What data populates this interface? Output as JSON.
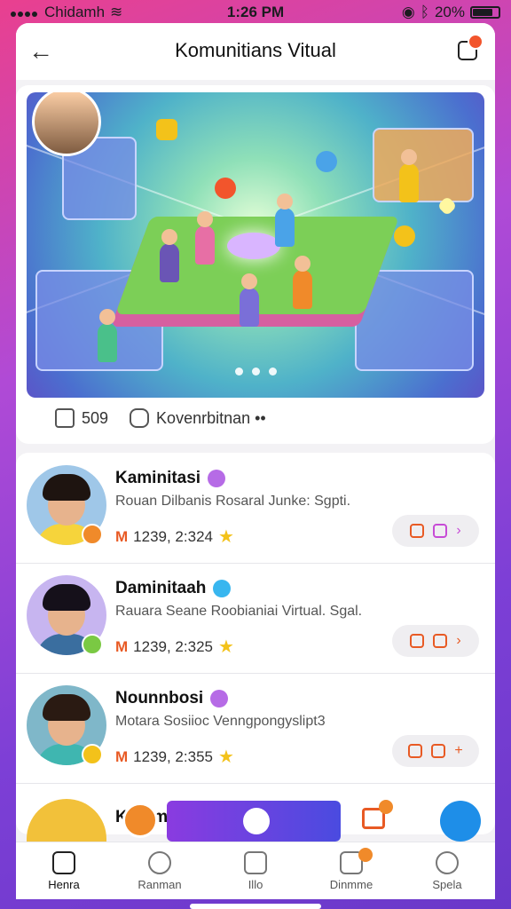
{
  "status": {
    "carrier": "Chidamh",
    "time": "1:26 PM",
    "battery": "20%"
  },
  "header": {
    "title": "Komunitians Vitual"
  },
  "hero": {
    "likes": "509",
    "comment_label": "Kovenrbitnan ••"
  },
  "list": [
    {
      "name": "Kaminitasi",
      "desc": "Rouan Dilbanis Rosaral Junke: Sgpti.",
      "stats": "1239, 2:324",
      "verified_color": "#b66be6",
      "corner_color": "#f08a2a",
      "hair": "#1e1410",
      "shirt": "#f6d43b",
      "bg": "#9fc7e8"
    },
    {
      "name": "Daminitaah",
      "desc": "Rauara Seane Roobianiai Virtual. Sgal.",
      "stats": "1239, 2:325",
      "verified_color": "#38b6ef",
      "corner_color": "#7ac943",
      "hair": "#15101a",
      "shirt": "#3a6e9f",
      "bg": "#c7b5f0"
    },
    {
      "name": "Nounnbosi",
      "desc": "Motara Sosiioc Venngpongyslipt3",
      "stats": "1239, 2:355",
      "verified_color": "#b66be6",
      "corner_color": "#f3c21a",
      "hair": "#2a1a12",
      "shirt": "#3fb6b0",
      "bg": "#7fb7c9"
    }
  ],
  "partial": {
    "name": "Kommbeah"
  },
  "tabs": [
    {
      "label": "Henra",
      "icon": "home-icon"
    },
    {
      "label": "Ranman",
      "icon": "explore-icon"
    },
    {
      "label": "Illo",
      "icon": "folder-icon"
    },
    {
      "label": "Dinmme",
      "icon": "calendar-icon"
    },
    {
      "label": "Spela",
      "icon": "search-icon"
    }
  ]
}
